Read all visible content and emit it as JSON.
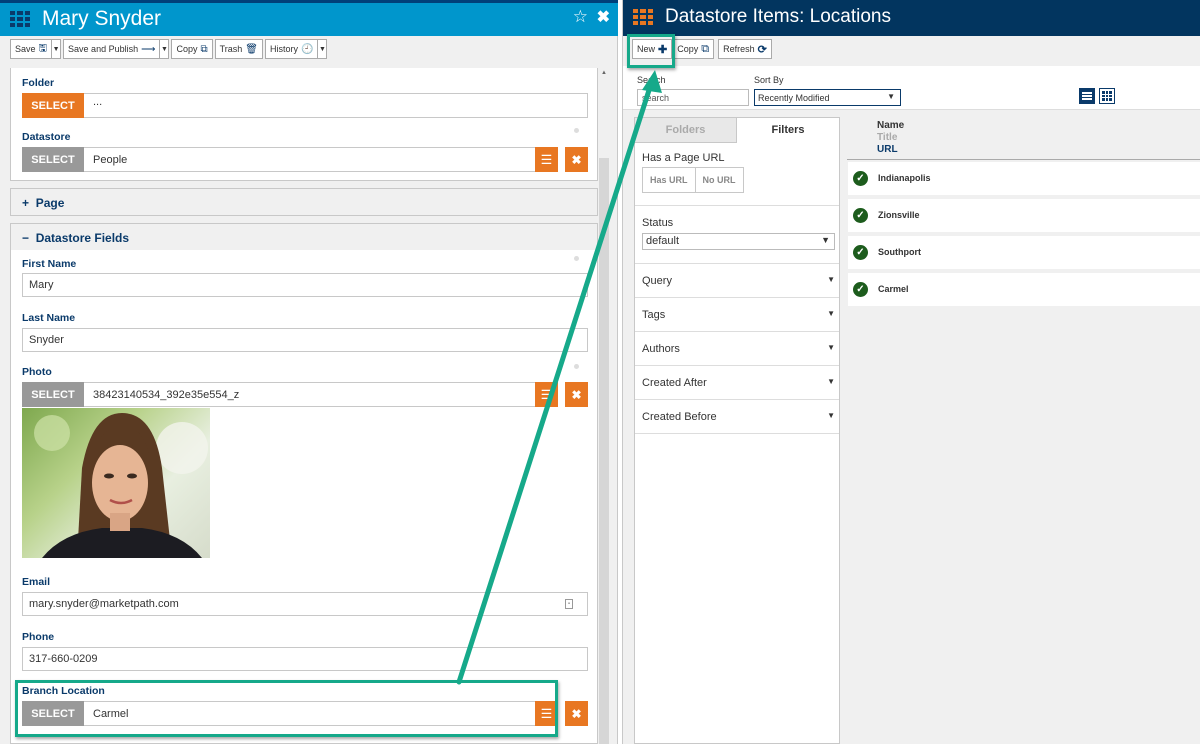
{
  "left_pane": {
    "title": "Mary Snyder",
    "icons": {
      "menu": "grid-icon",
      "favorite": "star-outline-icon",
      "close": "close-icon"
    },
    "toolbar": {
      "save": "Save",
      "save_and_publish": "Save and Publish",
      "copy": "Copy",
      "trash": "Trash",
      "history": "History"
    },
    "fields": {
      "folder": {
        "label": "Folder",
        "button": "SELECT",
        "value": "..."
      },
      "datastore": {
        "label": "Datastore",
        "button": "SELECT",
        "value": "People"
      }
    },
    "sections": {
      "page": {
        "toggle": "+",
        "label": "Page"
      },
      "datastore_fields": {
        "toggle": "−",
        "label": "Datastore Fields"
      }
    },
    "datastore_fields": {
      "first_name": {
        "label": "First Name",
        "value": "Mary"
      },
      "last_name": {
        "label": "Last Name",
        "value": "Snyder"
      },
      "photo": {
        "label": "Photo",
        "button": "SELECT",
        "value": "38423140534_392e35e554_z"
      },
      "email": {
        "label": "Email",
        "value": "mary.snyder@marketpath.com"
      },
      "phone": {
        "label": "Phone",
        "value": "317-660-0209"
      },
      "branch_location": {
        "label": "Branch Location",
        "button": "SELECT",
        "value": "Carmel"
      }
    }
  },
  "right_pane": {
    "title": "Datastore Items: Locations",
    "toolbar": {
      "new": "New",
      "copy": "Copy",
      "refresh": "Refresh"
    },
    "search": {
      "label": "Search",
      "placeholder": "search",
      "value": ""
    },
    "sort": {
      "label": "Sort By",
      "selected": "Recently Modified"
    },
    "filter_tabs": {
      "folders": "Folders",
      "filters": "Filters",
      "active": "Filters"
    },
    "filters": {
      "has_page_url": {
        "label": "Has a Page URL",
        "options": [
          "Has URL",
          "No URL"
        ]
      },
      "status": {
        "label": "Status",
        "selected": "default"
      },
      "accordions": [
        "Query",
        "Tags",
        "Authors",
        "Created After",
        "Created Before"
      ]
    },
    "list_header": {
      "name": "Name",
      "title": "Title",
      "url": "URL"
    },
    "items": [
      {
        "name": "Indianapolis",
        "status": "published"
      },
      {
        "name": "Zionsville",
        "status": "published"
      },
      {
        "name": "Southport",
        "status": "published"
      },
      {
        "name": "Carmel",
        "status": "published"
      }
    ]
  },
  "colors": {
    "left_header": "#0096cc",
    "right_header": "#02355f",
    "accent_orange": "#e87722",
    "label_navy": "#0a3a6a",
    "annotation_green": "#16a98a",
    "status_green": "#1d5c1d"
  }
}
